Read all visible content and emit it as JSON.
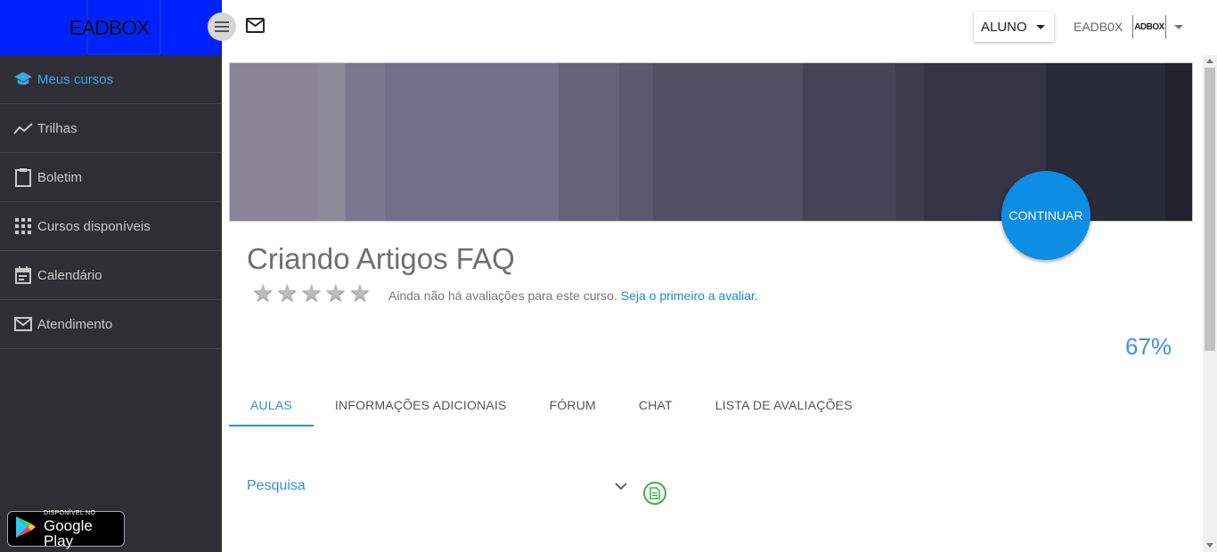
{
  "brand": {
    "logo_text": "EADBOX"
  },
  "sidebar": {
    "items": [
      {
        "label": "Meus cursos",
        "icon": "graduation-cap-icon",
        "active": true
      },
      {
        "label": "Trilhas",
        "icon": "trending-line-icon",
        "active": false
      },
      {
        "label": "Boletim",
        "icon": "clipboard-icon",
        "active": false
      },
      {
        "label": "Cursos disponíveis",
        "icon": "grid-icon",
        "active": false
      },
      {
        "label": "Calendário",
        "icon": "calendar-icon",
        "active": false
      },
      {
        "label": "Atendimento",
        "icon": "mail-icon",
        "active": false
      }
    ],
    "google_play": {
      "small": "DISPONÍVEL NO",
      "big": "Google Play"
    }
  },
  "topbar": {
    "role": "ALUNO",
    "user_name": "EADB0X",
    "user_logo_text": "ADBOX"
  },
  "course": {
    "title": "Criando Artigos FAQ",
    "continue_label": "CONTINUAR",
    "rating_text": "Ainda não há avaliações para este curso.",
    "rating_link": "Seja o primeiro a avaliar.",
    "stars": 5,
    "progress": "67%"
  },
  "tabs": [
    {
      "label": "AULAS",
      "active": true
    },
    {
      "label": "INFORMAÇÕES ADICIONAIS",
      "active": false
    },
    {
      "label": "FÓRUM",
      "active": false
    },
    {
      "label": "CHAT",
      "active": false
    },
    {
      "label": "LISTA DE AVALIAÇÕES",
      "active": false
    }
  ],
  "lessons": [
    {
      "label": "Pesquisa"
    }
  ],
  "colors": {
    "accent": "#3aa8e4",
    "brand_blue": "#0022ff",
    "sidebar_bg": "#2f2e36",
    "continue_button": "#0d8de4"
  }
}
